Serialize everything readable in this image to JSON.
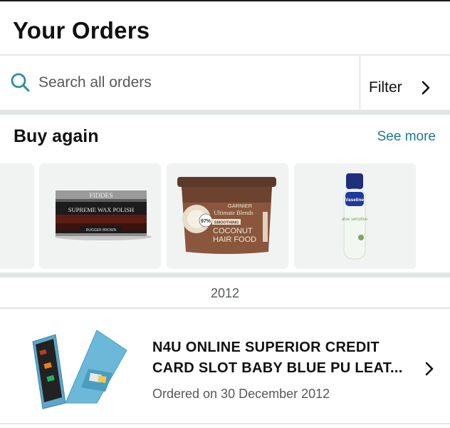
{
  "header": {
    "title": "Your Orders"
  },
  "search": {
    "placeholder": "Search all orders",
    "value": "",
    "icon": "search-icon"
  },
  "filter": {
    "label": "Filter",
    "icon": "chevron-right-icon"
  },
  "buy_again": {
    "heading": "Buy again",
    "see_more": "See more",
    "items": [
      {
        "name": "partially visible product"
      },
      {
        "name": "Fiddes Supreme Wax Polish",
        "brand_text": "FIDDES",
        "product_text": "SUPREME WAX POLISH",
        "shade_text": "RUGGER BROWN"
      },
      {
        "name": "Garnier Ultimate Blends Coconut Hair Food",
        "brand_text": "GARNIER",
        "line_text": "Ultimate Blends",
        "badge_text": "97%",
        "tag_text": "SMOOTHING",
        "product_text_1": "COCONUT",
        "product_text_2": "HAIR FOOD"
      },
      {
        "name": "Vaseline aloe sensitive spray",
        "brand_text": "Vaseline",
        "variant_text": "aloe sensitive"
      }
    ]
  },
  "orders": {
    "year": "2012",
    "items": [
      {
        "title": "N4U ONLINE SUPERIOR CREDIT CARD SLOT BABY BLUE PU LEAT...",
        "date_text": "Ordered on 30 December 2012",
        "image": "baby blue flip phone case"
      }
    ]
  },
  "colors": {
    "link": "#1c7a8a",
    "search_icon": "#2f8d9e",
    "divider": "#e3e6e6",
    "tile_bg": "#f1f2f2",
    "muted_text": "#565959"
  }
}
